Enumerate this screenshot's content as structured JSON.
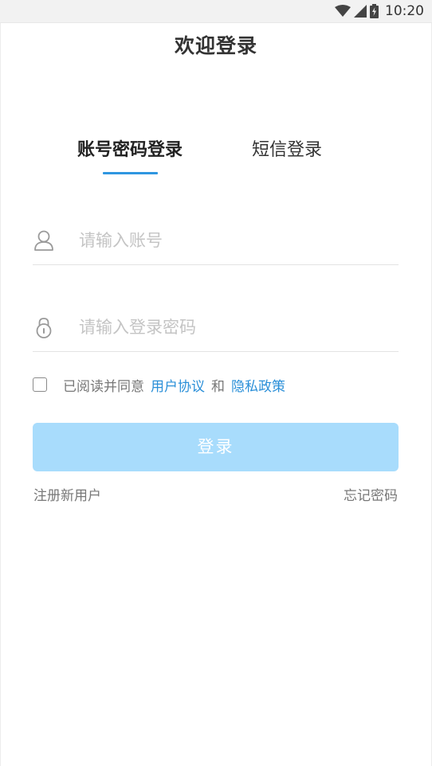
{
  "status_bar": {
    "time": "10:20",
    "icons": [
      "wifi-icon",
      "signal-icon",
      "battery-charging-icon"
    ]
  },
  "header": {
    "title": "欢迎登录"
  },
  "tabs": [
    {
      "label": "账号密码登录",
      "active": true
    },
    {
      "label": "短信登录",
      "active": false
    }
  ],
  "form": {
    "account": {
      "placeholder": "请输入账号",
      "value": "",
      "icon": "user-icon"
    },
    "password": {
      "placeholder": "请输入登录密码",
      "value": "",
      "icon": "lock-icon"
    }
  },
  "agreement": {
    "checked": false,
    "prefix": "已阅读并同意",
    "user_agreement": "用户协议",
    "and": "和",
    "privacy_policy": "隐私政策"
  },
  "login_button": {
    "label": "登录"
  },
  "links": {
    "register": "注册新用户",
    "forgot_password": "忘记密码"
  },
  "colors": {
    "accent": "#2f96e0",
    "link": "#2a8fd8",
    "button_disabled": "#a8dcfc",
    "placeholder": "#c4c4c4"
  }
}
